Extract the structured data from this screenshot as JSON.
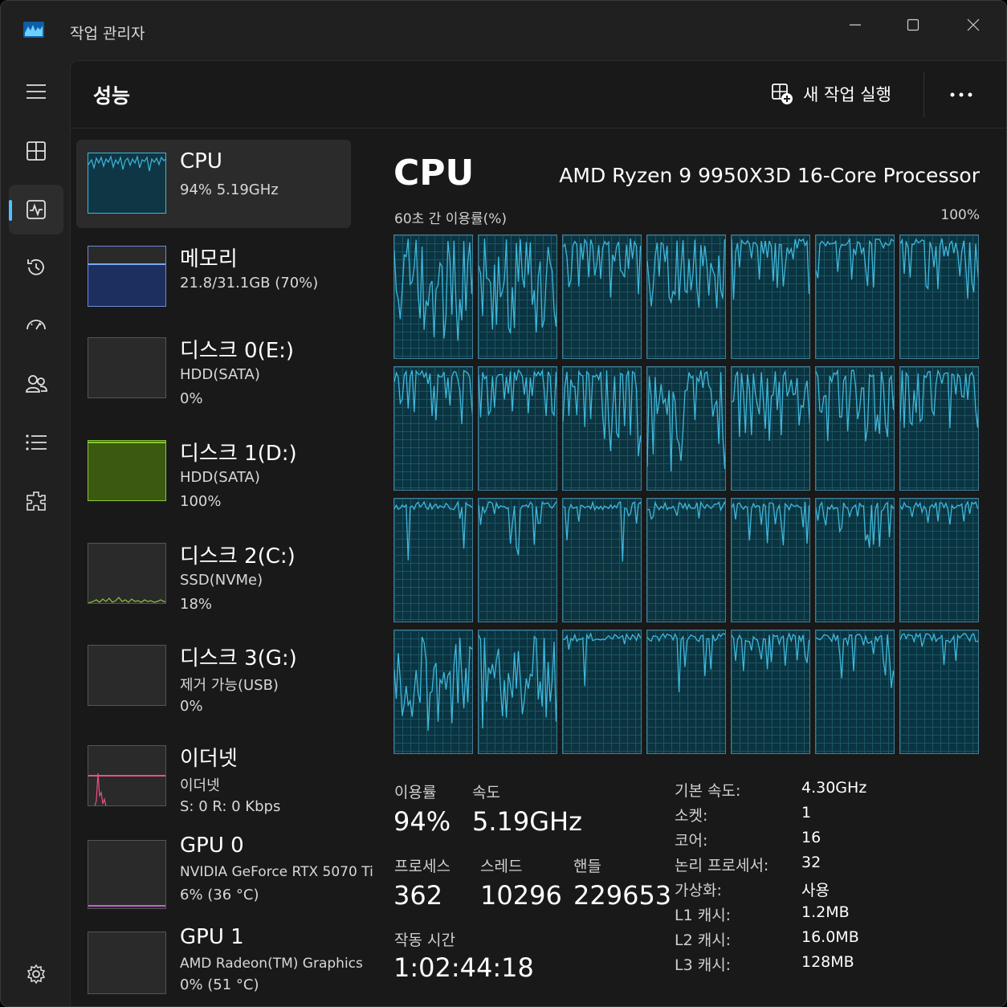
{
  "window": {
    "title": "작업 관리자"
  },
  "nav": {
    "items": [
      "menu-icon",
      "processes-icon",
      "performance-icon",
      "history-icon",
      "startup-icon",
      "users-icon",
      "details-icon",
      "services-icon"
    ],
    "settings": "settings-icon"
  },
  "header": {
    "title": "성능",
    "run_task": "새 작업 실행",
    "more": "more-icon"
  },
  "devices": [
    {
      "name": "CPU",
      "sub1": "94%  5.19GHz",
      "sub2": "",
      "color": "#3fb8dc"
    },
    {
      "name": "메모리",
      "sub1": "21.8/31.1GB  (70%)",
      "sub2": "",
      "color": "#7aa7ff"
    },
    {
      "name": "디스크 0(E:)",
      "sub1": "HDD(SATA)",
      "sub2": "0%",
      "color": "#89c63b"
    },
    {
      "name": "디스크 1(D:)",
      "sub1": "HDD(SATA)",
      "sub2": "100%",
      "color": "#89c63b"
    },
    {
      "name": "디스크 2(C:)",
      "sub1": "SSD(NVMe)",
      "sub2": "18%",
      "color": "#89c63b"
    },
    {
      "name": "디스크 3(G:)",
      "sub1": "제거 가능(USB)",
      "sub2": "0%",
      "color": "#89c63b"
    },
    {
      "name": "이더넷",
      "sub1": "이더넷",
      "sub2": "S:  0  R:  0  Kbps",
      "color": "#e8508a"
    },
    {
      "name": "GPU 0",
      "sub1": "NVIDIA GeForce RTX 5070 Ti",
      "sub2": "6%  (36 °C)",
      "color": "#c060d0"
    },
    {
      "name": "GPU 1",
      "sub1": "AMD Radeon(TM) Graphics",
      "sub2": "0%  (51 °C)",
      "color": "#c060d0"
    }
  ],
  "detail": {
    "title": "CPU",
    "model": "AMD Ryzen 9 9950X3D 16-Core Processor",
    "util_label": "60초 간 이용률(%)",
    "util_max": "100%",
    "stats": {
      "util_label": "이용률",
      "util_value": "94%",
      "speed_label": "속도",
      "speed_value": "5.19GHz",
      "processes_label": "프로세스",
      "processes_value": "362",
      "threads_label": "스레드",
      "threads_value": "10296",
      "handles_label": "핸들",
      "handles_value": "229653",
      "uptime_label": "작동 시간",
      "uptime_value": "1:02:44:18"
    },
    "specs": [
      {
        "label": "기본 속도:",
        "value": "4.30GHz"
      },
      {
        "label": "소켓:",
        "value": "1"
      },
      {
        "label": "코어:",
        "value": "16"
      },
      {
        "label": "논리 프로세서:",
        "value": "32"
      },
      {
        "label": "가상화:",
        "value": "사용"
      },
      {
        "label": "L1 캐시:",
        "value": "1.2MB"
      },
      {
        "label": "L2 캐시:",
        "value": "16.0MB"
      },
      {
        "label": "L3 캐시:",
        "value": "128MB"
      }
    ]
  },
  "colors": {
    "accent": "#4cc2ff",
    "graph_line": "#3fb8dc",
    "graph_fill": "#0b3440",
    "graph_grid": "#1a5566"
  }
}
